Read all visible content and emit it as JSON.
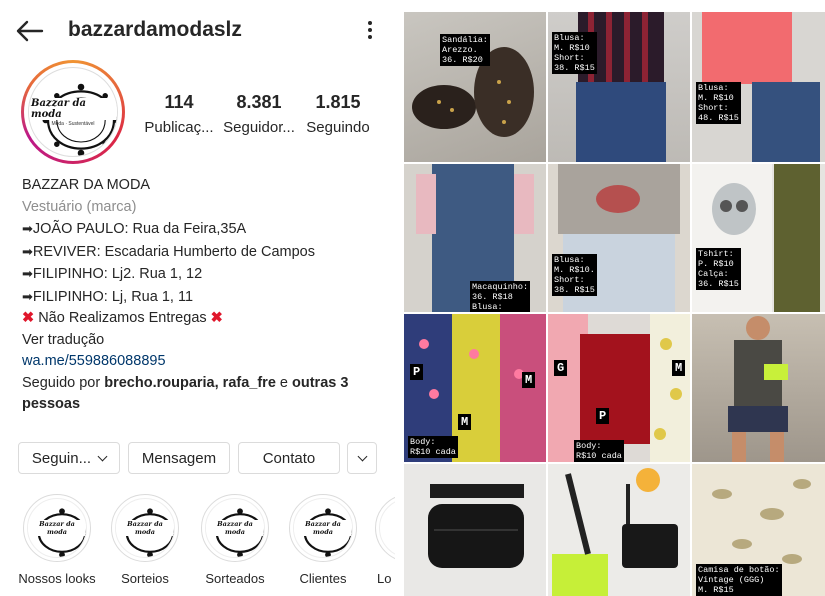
{
  "header": {
    "username": "bazzardamodaslz"
  },
  "stats": [
    {
      "number": "114",
      "label": "Publicaç..."
    },
    {
      "number": "8.381",
      "label": "Seguidor..."
    },
    {
      "number": "1.815",
      "label": "Seguindo"
    }
  ],
  "bio": {
    "name": "BAZZAR DA MODA",
    "category": "Vestuário (marca)",
    "lines": [
      "JOÃO PAULO: Rua da Feira,35A",
      "REVIVER: Escadaria Humberto de Campos",
      "FILIPINHO: Lj2. Rua 1, 12",
      "FILIPINHO: Lj, Rua 1, 11"
    ],
    "no_delivery": "Não Realizamos Entregas",
    "translate": "Ver tradução",
    "link": "wa.me/559886088895",
    "followed_prefix": "Seguido por ",
    "followed_names": "brecho.rouparia, rafa_fre",
    "followed_mid": " e ",
    "followed_others": "outras 3 pessoas"
  },
  "avatar": {
    "logo_text": "Bazzar da moda",
    "logo_sub": "Moda · Sustentável"
  },
  "buttons": {
    "follow": "Seguin...",
    "message": "Mensagem",
    "contact": "Contato"
  },
  "highlights": [
    {
      "label": "Nossos looks"
    },
    {
      "label": "Sorteios"
    },
    {
      "label": "Sorteados"
    },
    {
      "label": "Clientes"
    },
    {
      "label": "Lo"
    }
  ],
  "grid": {
    "tiles": [
      {
        "label": "Sandália:\nArezzo.\n36. R$20"
      },
      {
        "label": "Blusa:\nM. R$10\nShort:\n38. R$15"
      },
      {
        "label": "Blusa:\nM. R$10\nShort:\n48. R$15"
      },
      {
        "label": "Macaquinho:\n36. R$18\nBlusa:"
      },
      {
        "label": "Blusa:\nM. R$10.\nShort:\n38. R$15"
      },
      {
        "label": "Tshirt:\nP. R$10\nCalça:\n36. R$15"
      },
      {
        "label": "Body:\nR$10 cada"
      },
      {
        "label": "Body:\nR$10 cada"
      },
      {
        "label": ""
      },
      {
        "label": ""
      },
      {
        "label": ""
      },
      {
        "label": "Camisa de botão:\nVintage (GGG)\nM. R$15"
      }
    ],
    "size_tags": {
      "p": "P",
      "m": "M",
      "g": "G"
    }
  },
  "colors": {
    "link": "#00376b",
    "muted": "#8e8e8e",
    "x_mark": "#e0162b"
  }
}
